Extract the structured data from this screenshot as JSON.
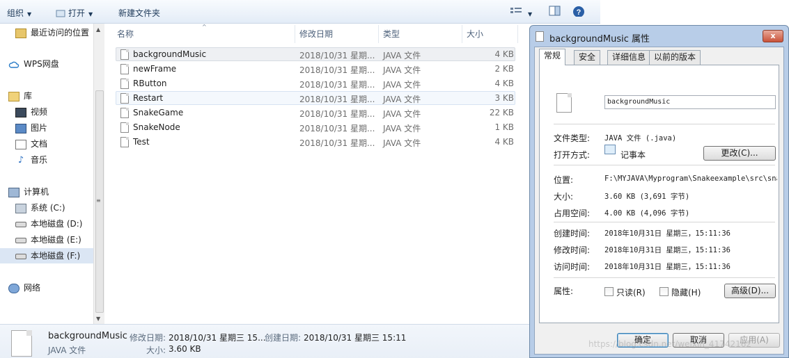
{
  "toolbar": {
    "organize": "组织",
    "open": "打开",
    "new_folder": "新建文件夹"
  },
  "sidebar": {
    "recent": "最近访问的位置",
    "wps": "WPS网盘",
    "libraries": "库",
    "videos": "视频",
    "pictures": "图片",
    "documents": "文档",
    "music": "音乐",
    "computer": "计算机",
    "drive_c": "系统 (C:)",
    "drive_d": "本地磁盘 (D:)",
    "drive_e": "本地磁盘 (E:)",
    "drive_f": "本地磁盘 (F:)",
    "network": "网络"
  },
  "columns": {
    "name": "名称",
    "date": "修改日期",
    "type": "类型",
    "size": "大小"
  },
  "files": [
    {
      "name": "backgroundMusic",
      "date": "2018/10/31 星期...",
      "type": "JAVA 文件",
      "size": "4 KB"
    },
    {
      "name": "newFrame",
      "date": "2018/10/31 星期...",
      "type": "JAVA 文件",
      "size": "2 KB"
    },
    {
      "name": "RButton",
      "date": "2018/10/31 星期...",
      "type": "JAVA 文件",
      "size": "4 KB"
    },
    {
      "name": "Restart",
      "date": "2018/10/31 星期...",
      "type": "JAVA 文件",
      "size": "3 KB"
    },
    {
      "name": "SnakeGame",
      "date": "2018/10/31 星期...",
      "type": "JAVA 文件",
      "size": "22 KB"
    },
    {
      "name": "SnakeNode",
      "date": "2018/10/31 星期...",
      "type": "JAVA 文件",
      "size": "1 KB"
    },
    {
      "name": "Test",
      "date": "2018/10/31 星期...",
      "type": "JAVA 文件",
      "size": "4 KB"
    }
  ],
  "details": {
    "name": "backgroundMusic",
    "modified_label": "修改日期:",
    "modified": "2018/10/31 星期三 15...",
    "created_label": "创建日期:",
    "created": "2018/10/31 星期三 15:11",
    "type": "JAVA 文件",
    "size_label": "大小:",
    "size": "3.60 KB"
  },
  "dialog": {
    "title": "backgroundMusic 属性",
    "close": "x",
    "tabs": [
      "常规",
      "安全",
      "详细信息",
      "以前的版本"
    ],
    "filename": "backgroundMusic",
    "file_type_label": "文件类型:",
    "file_type": "JAVA 文件 (.java)",
    "open_with_label": "打开方式:",
    "open_with": "记事本",
    "change_button": "更改(C)...",
    "location_label": "位置:",
    "location": "F:\\MYJAVA\\Myprogram\\Snakeexample\\src\\snak",
    "size_label": "大小:",
    "size": "3.60 KB (3,691 字节)",
    "disk_size_label": "占用空间:",
    "disk_size": "4.00 KB (4,096 字节)",
    "created_label": "创建时间:",
    "created": "2018年10月31日 星期三，15:11:36",
    "modified_label": "修改时间:",
    "modified": "2018年10月31日 星期三，15:11:36",
    "accessed_label": "访问时间:",
    "accessed": "2018年10月31日 星期三，15:11:36",
    "attributes_label": "属性:",
    "readonly": "只读(R)",
    "hidden": "隐藏(H)",
    "advanced_button": "高级(D)...",
    "ok_button": "确定",
    "cancel_button": "取消",
    "apply_button": "应用(A)"
  },
  "watermark": "https://blog.csdn.net/weixin_41742162"
}
